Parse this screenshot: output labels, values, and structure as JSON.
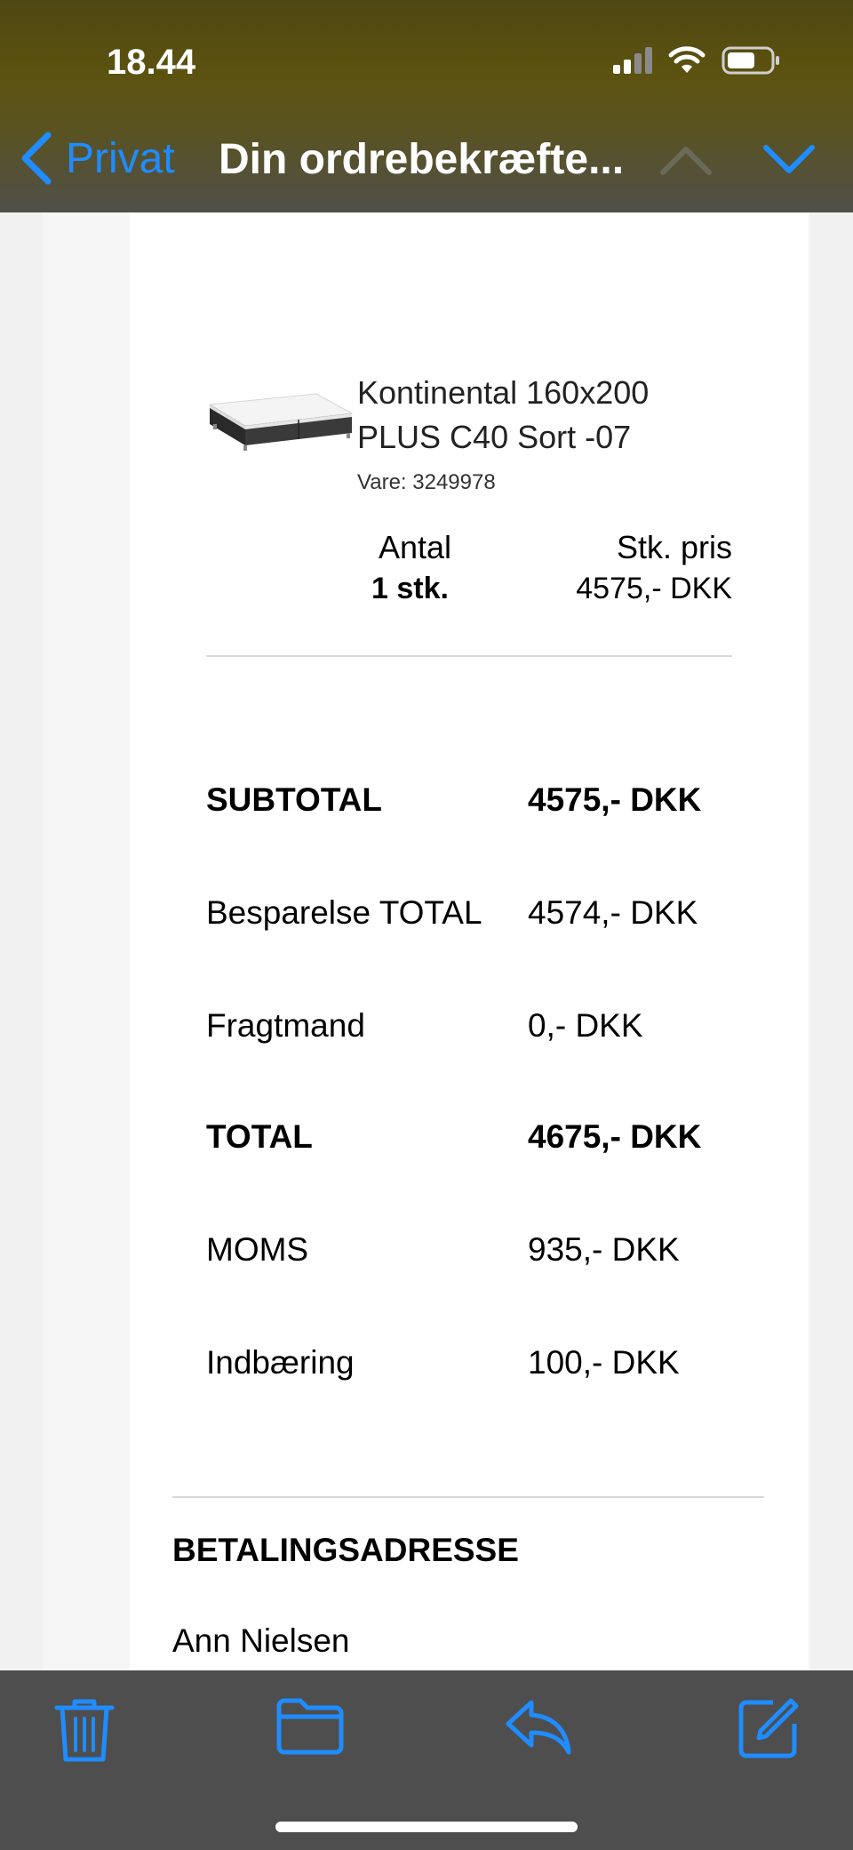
{
  "status": {
    "time": "18.44"
  },
  "nav": {
    "back_label": "Privat",
    "title": "Din ordrebekræfte..."
  },
  "product": {
    "name_line1": "Kontinental 160x200",
    "name_line2": "PLUS C40 Sort -07",
    "sku": "Vare: 3249978",
    "qty_label": "Antal",
    "qty_value": "1 stk.",
    "price_label": "Stk. pris",
    "price_value": "4575,- DKK"
  },
  "totals": [
    {
      "label": "SUBTOTAL",
      "value": "4575,- DKK",
      "bold": true
    },
    {
      "label": "Besparelse TOTAL",
      "value": "4574,- DKK",
      "bold": false
    },
    {
      "label": "Fragtmand",
      "value": "0,- DKK",
      "bold": false
    },
    {
      "label": "TOTAL",
      "value": "4675,- DKK",
      "bold": true
    },
    {
      "label": "MOMS",
      "value": "935,- DKK",
      "bold": false
    },
    {
      "label": "Indbæring",
      "value": "100,- DKK",
      "bold": false
    }
  ],
  "billing": {
    "title": "BETALINGSADRESSE",
    "name": "Ann Nielsen"
  },
  "toolbar": {
    "icons": [
      "trash-icon",
      "folder-icon",
      "reply-icon",
      "compose-icon"
    ]
  },
  "colors": {
    "accent": "#1f8cff",
    "toolbar_bg": "#4e4e4e",
    "topbar_bg": "#5c5210"
  }
}
